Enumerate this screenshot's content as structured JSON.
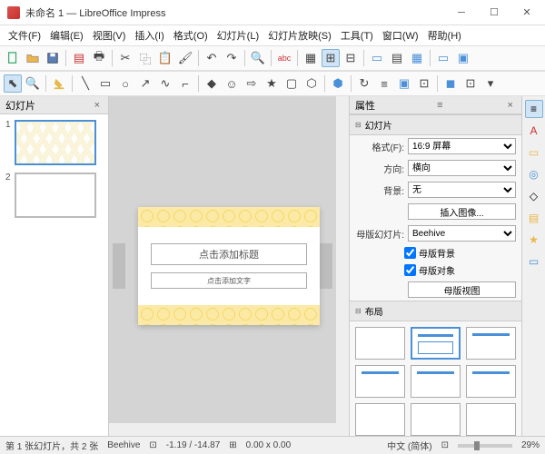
{
  "window": {
    "title": "未命名 1 — LibreOffice Impress"
  },
  "menu": {
    "file": "文件(F)",
    "edit": "编辑(E)",
    "view": "视图(V)",
    "insert": "插入(I)",
    "format": "格式(O)",
    "slide": "幻灯片(L)",
    "slideshow": "幻灯片放映(S)",
    "tools": "工具(T)",
    "window": "窗口(W)",
    "help": "帮助(H)"
  },
  "panels": {
    "slides_title": "幻灯片",
    "properties_title": "属性"
  },
  "slides": [
    {
      "num": "1",
      "selected": true
    },
    {
      "num": "2",
      "selected": false
    }
  ],
  "canvas": {
    "title_placeholder": "点击添加标题",
    "text_placeholder": "点击添加文字"
  },
  "properties": {
    "section_slide": "幻灯片",
    "format_label": "格式(F):",
    "format_value": "16:9 屏幕",
    "orientation_label": "方向:",
    "orientation_value": "横向",
    "background_label": "背景:",
    "background_value": "无",
    "insert_image_btn": "插入图像...",
    "master_label": "母版幻灯片:",
    "master_value": "Beehive",
    "master_bg_chk": "母版背景",
    "master_obj_chk": "母版对象",
    "master_view_btn": "母版视图",
    "section_layout": "布局"
  },
  "status": {
    "slide_count": "第 1 张幻灯片，共 2 张",
    "template": "Beehive",
    "coords": "-1.19 / -14.87",
    "size": "0.00 x 0.00",
    "lang": "中文 (简体)",
    "zoom": "29%"
  }
}
